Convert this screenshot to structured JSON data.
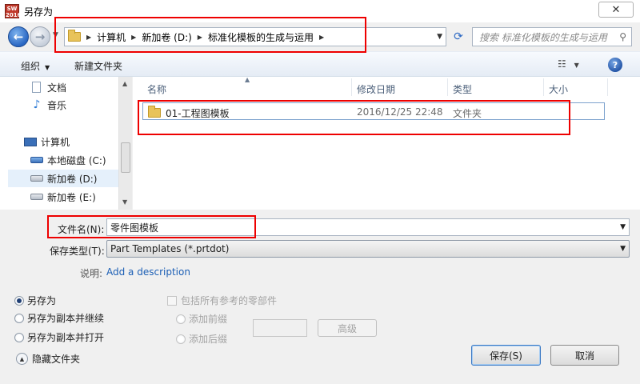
{
  "window": {
    "title": "另存为",
    "app_icon_text": "SW 2016",
    "close_symbol": "✕"
  },
  "nav": {
    "breadcrumbs": [
      "计算机",
      "新加卷 (D:)",
      "标准化模板的生成与运用"
    ],
    "search_placeholder": "搜索 标准化模板的生成与运用"
  },
  "toolbar": {
    "organize_label": "组织",
    "new_folder_label": "新建文件夹"
  },
  "sidebar": {
    "items": [
      {
        "label": "文档",
        "icon": "document-icon"
      },
      {
        "label": "音乐",
        "icon": "music-icon"
      },
      {
        "label": "计算机",
        "icon": "computer-icon"
      },
      {
        "label": "本地磁盘 (C:)",
        "icon": "drive-icon"
      },
      {
        "label": "新加卷 (D:)",
        "icon": "drive-icon",
        "selected": true
      },
      {
        "label": "新加卷 (E:)",
        "icon": "drive-icon"
      }
    ]
  },
  "filelist": {
    "columns": [
      "名称",
      "修改日期",
      "类型",
      "大小"
    ],
    "rows": [
      {
        "name": "01-工程图模板",
        "date": "2016/12/25 22:48",
        "type": "文件夹",
        "size": ""
      }
    ]
  },
  "form": {
    "filename_label": "文件名(N):",
    "filename_value": "零件图模板",
    "filetype_label": "保存类型(T):",
    "filetype_value": "Part Templates (*.prtdot)",
    "description_label": "说明:",
    "description_link": "Add a description"
  },
  "options": {
    "save_as": "另存为",
    "save_copy_continue": "另存为副本并继续",
    "save_copy_open": "另存为副本并打开",
    "include_refs": "包括所有参考的零部件",
    "add_prefix": "添加前缀",
    "add_suffix": "添加后缀",
    "advanced_button": "高级"
  },
  "buttons": {
    "hide_folders": "隐藏文件夹",
    "save": "保存(S)",
    "cancel": "取消"
  },
  "colors": {
    "annotation_red": "#e00000",
    "link_blue": "#1c5fb5"
  }
}
